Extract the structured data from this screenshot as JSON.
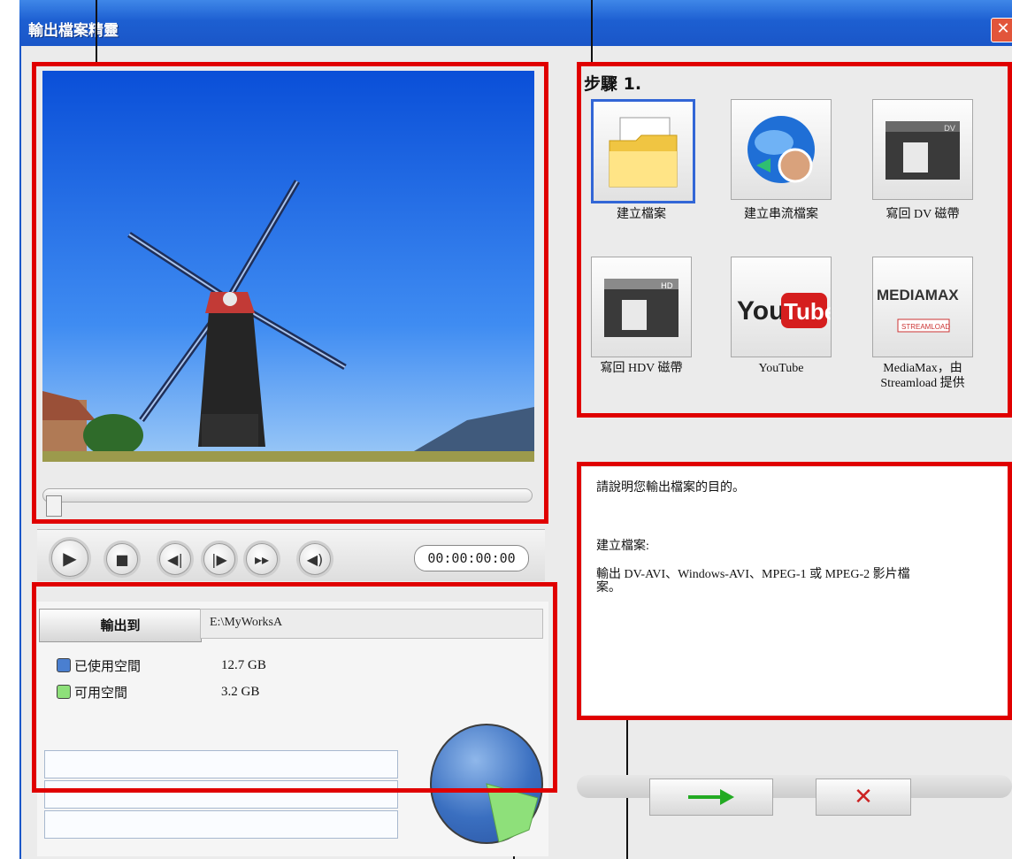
{
  "window": {
    "title": "輸出檔案精靈",
    "close_label": "✕"
  },
  "player": {
    "timecode": "00:00:00:00"
  },
  "output": {
    "button_label": "輸出到",
    "path": "E:\\MyWorksA",
    "legend": [
      {
        "label": "已使用空間",
        "value": "12.7 GB",
        "color": "#4a7fd0"
      },
      {
        "label": "可用空間",
        "value": "3.2 GB",
        "color": "#8ee07a"
      }
    ]
  },
  "step": {
    "title": "步驟 1.",
    "tiles": [
      {
        "label": "建立檔案",
        "icon": "folder-icon"
      },
      {
        "label": "建立串流檔案",
        "icon": "globe-stream-icon"
      },
      {
        "label": "寫回 DV 磁帶",
        "icon": "dv-tape-icon"
      },
      {
        "label": "寫回 HDV 磁帶",
        "icon": "hdv-tape-icon"
      },
      {
        "label": "YouTube",
        "icon": "youtube-logo-icon"
      },
      {
        "label": "MediaMax，由 Streamload 提供",
        "icon": "mediamax-logo-icon"
      }
    ]
  },
  "description": {
    "prompt": "請說明您輸出檔案的目的。",
    "heading": "建立檔案:",
    "body_line1": "輸出 DV-AVI、Windows-AVI、MPEG-1 或 MPEG-2 影片檔",
    "body_line2": "案。"
  },
  "logos": {
    "youtube_you": "You",
    "youtube_tube": "Tube",
    "mediamax": "MEDIAMAX",
    "streamload": "STREAMLOAD",
    "hd": "HD",
    "dv": "DV"
  },
  "colors": {
    "selection": "#3266d6",
    "highlight": "#e00000",
    "next_arrow": "#22aa22",
    "cancel_x": "#cc2222"
  }
}
